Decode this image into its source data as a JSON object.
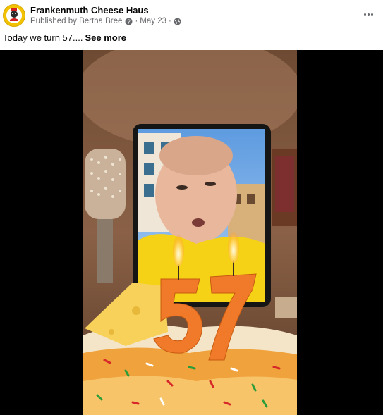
{
  "post": {
    "page_name": "Frankenmuth Cheese Haus",
    "published_by_prefix": "Published by",
    "author": "Bertha Bree",
    "date": "May 23",
    "separator": "·",
    "caption_text": "Today we turn 57....",
    "see_more_label": "See more"
  },
  "icons": {
    "avatar": "cheese-haus-logo",
    "author_badge": "question-circle-icon",
    "audience": "globe-icon",
    "more": "more-options-icon"
  },
  "colors": {
    "text_primary": "#050505",
    "text_secondary": "#65676b",
    "avatar_bg": "#f2c200",
    "candle_orange": "#f07a2a"
  },
  "video": {
    "candle_digits": "57"
  }
}
